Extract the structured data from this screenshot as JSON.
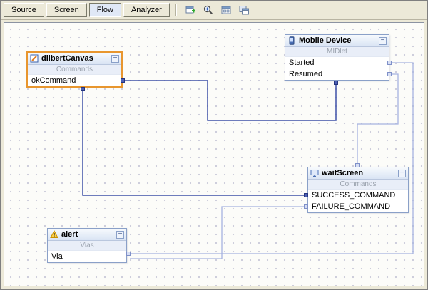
{
  "toolbar": {
    "tabs": [
      {
        "label": "Source",
        "active": false
      },
      {
        "label": "Screen",
        "active": false
      },
      {
        "label": "Flow",
        "active": true
      },
      {
        "label": "Analyzer",
        "active": false
      }
    ],
    "icons": [
      "new-component-icon",
      "zoom-icon",
      "fit-diagram-icon",
      "export-image-icon"
    ]
  },
  "ui": {
    "collapse_glyph": "−"
  },
  "canvas": {
    "components": [
      {
        "title": "dilbertCanvas",
        "section": "Commands",
        "items": [
          "okCommand"
        ],
        "selected": true,
        "icon": "canvas-icon"
      },
      {
        "title": "Mobile Device",
        "section": "MIDlet",
        "items": [
          "Started",
          "Resumed"
        ],
        "selected": false,
        "icon": "mobile-device-icon"
      },
      {
        "title": "waitScreen",
        "section": "Commands",
        "items": [
          "SUCCESS_COMMAND",
          "FAILURE_COMMAND"
        ],
        "selected": false,
        "icon": "screen-icon"
      },
      {
        "title": "alert",
        "section": "Vias",
        "items": [
          "Via"
        ],
        "selected": false,
        "icon": "alert-warning-icon"
      }
    ],
    "connections": [
      {
        "from": "dilbertCanvas.okCommand",
        "to": "Mobile Device",
        "style": "dark"
      },
      {
        "from": "waitScreen.SUCCESS_COMMAND",
        "to": "dilbertCanvas",
        "style": "dark"
      },
      {
        "from": "Mobile Device.Started",
        "to": "alert",
        "style": "light"
      },
      {
        "from": "Mobile Device.Resumed",
        "to": "waitScreen",
        "style": "light"
      },
      {
        "from": "waitScreen.FAILURE_COMMAND",
        "to": "alert",
        "style": "light"
      }
    ],
    "colors": {
      "dark_link": "#3f51a8",
      "light_link": "#a6b3e0",
      "selection": "#e8962e"
    }
  }
}
